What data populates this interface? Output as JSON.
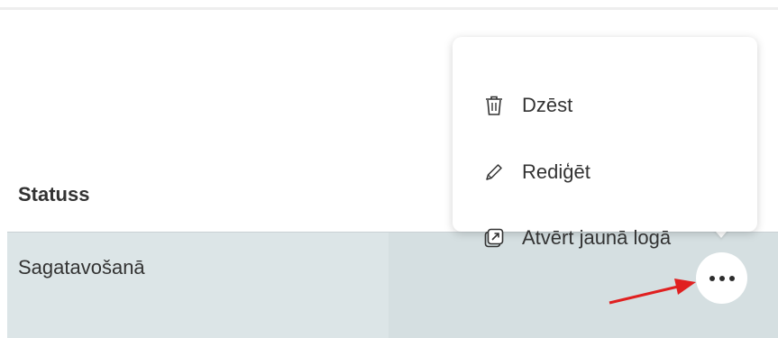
{
  "table": {
    "header_status": "Statuss",
    "rows": [
      {
        "status": "Sagatavošanā"
      }
    ]
  },
  "context_menu": {
    "items": [
      {
        "label": "Dzēst",
        "icon": "trash-icon"
      },
      {
        "label": "Rediģēt",
        "icon": "pencil-icon"
      },
      {
        "label": "Atvērt jaunā logā",
        "icon": "open-in-new-window-icon"
      }
    ]
  },
  "row_actions": {
    "more_icon": "more-horizontal-icon"
  },
  "annotation": {
    "arrow_color": "#e02020"
  },
  "colors": {
    "row_background": "#dce5e7",
    "text": "#333333",
    "menu_background": "#ffffff"
  }
}
